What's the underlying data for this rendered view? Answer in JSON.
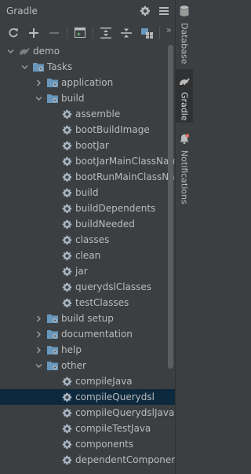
{
  "panel": {
    "title": "Gradle",
    "header_icons": [
      "gear-icon",
      "minimize-icon"
    ],
    "toolbar_icons": [
      "refresh-icon",
      "add-icon",
      "remove-icon",
      "run-task-icon",
      "expand-all-icon",
      "collapse-all-icon",
      "group-modules-icon"
    ],
    "toolbar_overflow": "»"
  },
  "tree": [
    {
      "label": "demo",
      "depth": 0,
      "expanded": true,
      "icon": "project-icon"
    },
    {
      "label": "Tasks",
      "depth": 1,
      "expanded": true,
      "icon": "folder-icon"
    },
    {
      "label": "application",
      "depth": 2,
      "expanded": false,
      "icon": "task-group-icon"
    },
    {
      "label": "build",
      "depth": 2,
      "expanded": true,
      "icon": "task-group-icon"
    },
    {
      "label": "assemble",
      "depth": 3,
      "icon": "gear-icon"
    },
    {
      "label": "bootBuildImage",
      "depth": 3,
      "icon": "gear-icon"
    },
    {
      "label": "bootJar",
      "depth": 3,
      "icon": "gear-icon"
    },
    {
      "label": "bootJarMainClassName",
      "depth": 3,
      "icon": "gear-icon"
    },
    {
      "label": "bootRunMainClassNam",
      "depth": 3,
      "icon": "gear-icon"
    },
    {
      "label": "build",
      "depth": 3,
      "icon": "gear-icon"
    },
    {
      "label": "buildDependents",
      "depth": 3,
      "icon": "gear-icon"
    },
    {
      "label": "buildNeeded",
      "depth": 3,
      "icon": "gear-icon"
    },
    {
      "label": "classes",
      "depth": 3,
      "icon": "gear-icon"
    },
    {
      "label": "clean",
      "depth": 3,
      "icon": "gear-icon"
    },
    {
      "label": "jar",
      "depth": 3,
      "icon": "gear-icon"
    },
    {
      "label": "querydslClasses",
      "depth": 3,
      "icon": "gear-icon"
    },
    {
      "label": "testClasses",
      "depth": 3,
      "icon": "gear-icon"
    },
    {
      "label": "build setup",
      "depth": 2,
      "expanded": false,
      "icon": "task-group-icon"
    },
    {
      "label": "documentation",
      "depth": 2,
      "expanded": false,
      "icon": "task-group-icon"
    },
    {
      "label": "help",
      "depth": 2,
      "expanded": false,
      "icon": "task-group-icon"
    },
    {
      "label": "other",
      "depth": 2,
      "expanded": true,
      "icon": "task-group-icon"
    },
    {
      "label": "compileJava",
      "depth": 3,
      "icon": "gear-icon"
    },
    {
      "label": "compileQuerydsl",
      "depth": 3,
      "icon": "gear-icon",
      "selected": true
    },
    {
      "label": "compileQuerydslJava",
      "depth": 3,
      "icon": "gear-icon"
    },
    {
      "label": "compileTestJava",
      "depth": 3,
      "icon": "gear-icon"
    },
    {
      "label": "components",
      "depth": 3,
      "icon": "gear-icon"
    },
    {
      "label": "dependentComponents",
      "depth": 3,
      "icon": "gear-icon"
    }
  ],
  "sidebar": [
    {
      "label": "Database",
      "icon": "database-icon",
      "active": false
    },
    {
      "label": "Gradle",
      "icon": "gradle-icon",
      "active": true
    },
    {
      "label": "Notifications",
      "icon": "bell-icon",
      "active": false
    }
  ],
  "colors": {
    "background": "#3c3f41",
    "selected_row": "#0d293e",
    "text": "#bbbbbb",
    "folder_blue": "#6897bb",
    "gear_gray": "#a9b7c6"
  }
}
